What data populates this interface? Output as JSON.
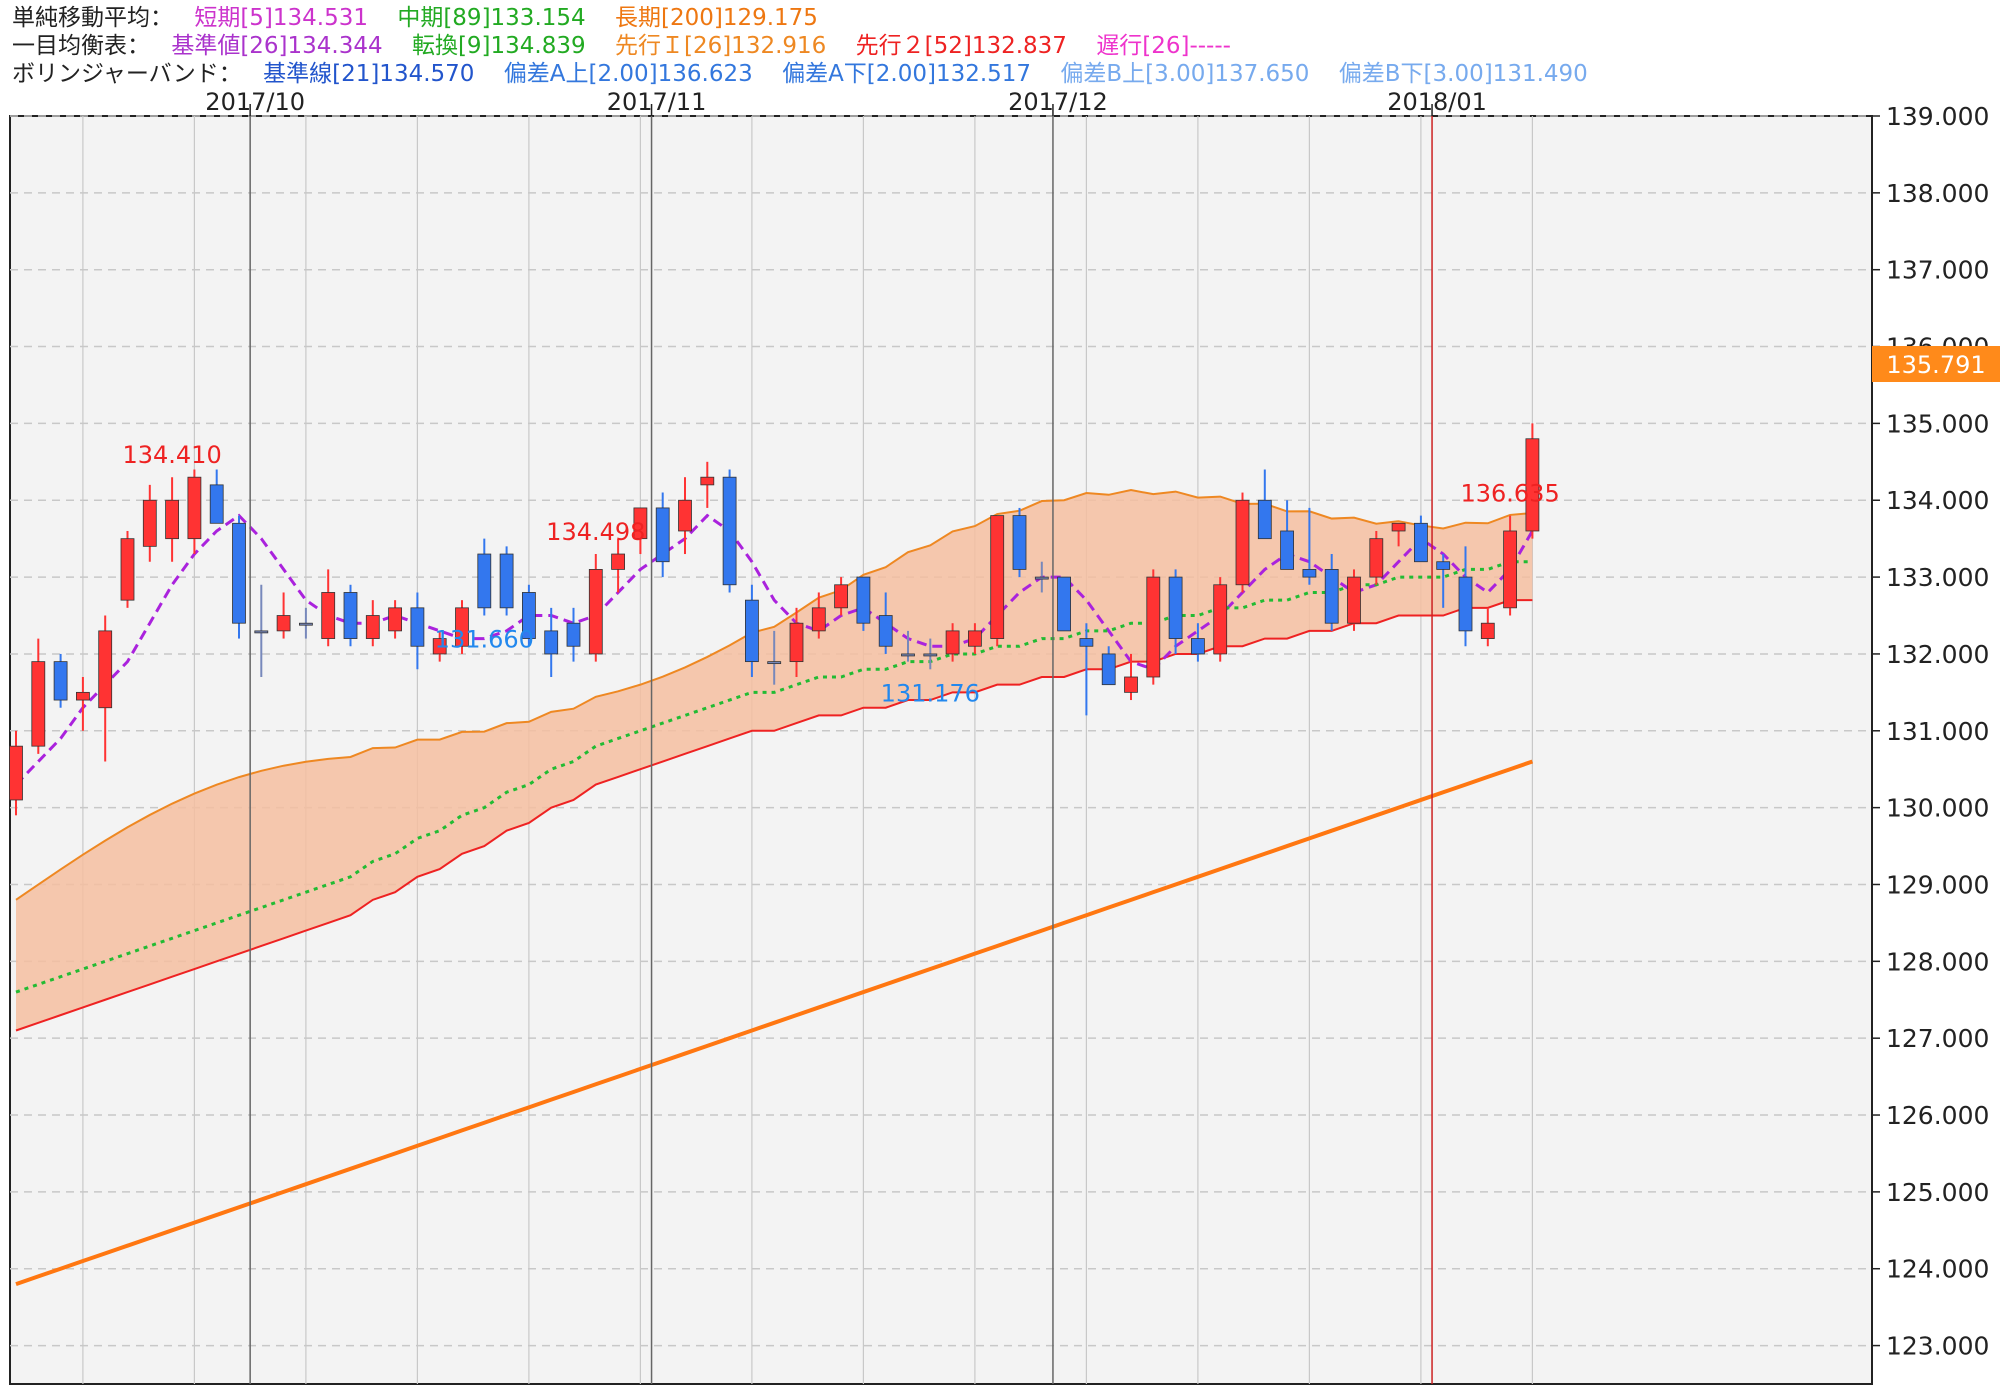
{
  "legend": {
    "sma": {
      "title": "単純移動平均：",
      "items": [
        {
          "text": "短期[5]134.531",
          "color": "#cc33cc"
        },
        {
          "text": "中期[89]133.154",
          "color": "#22aa22"
        },
        {
          "text": "長期[200]129.175",
          "color": "#ee7711"
        }
      ]
    },
    "ichimoku": {
      "title": "一目均衡表：",
      "items": [
        {
          "text": "基準値[26]134.344",
          "color": "#aa33cc"
        },
        {
          "text": "転換[9]134.839",
          "color": "#22aa22"
        },
        {
          "text": "先行Ｉ[26]132.916",
          "color": "#ee8822"
        },
        {
          "text": "先行２[52]132.837",
          "color": "#ee2222"
        },
        {
          "text": "遅行[26]-----",
          "color": "#ee33cc"
        }
      ]
    },
    "bollinger": {
      "title": "ボリンジャーバンド：",
      "items": [
        {
          "text": "基準線[21]134.570",
          "color": "#2255cc"
        },
        {
          "text": "偏差A上[2.00]136.623",
          "color": "#3377dd"
        },
        {
          "text": "偏差A下[2.00]132.517",
          "color": "#3377dd"
        },
        {
          "text": "偏差B上[3.00]137.650",
          "color": "#77aaee"
        },
        {
          "text": "偏差B下[3.00]131.490",
          "color": "#77aaee"
        }
      ]
    }
  },
  "current_price": "135.791",
  "colors": {
    "up": "#ff3333",
    "down": "#3377ee",
    "flat": "#7788bb",
    "cloud": "#f5bea0",
    "background": "#f3f3f3"
  },
  "chart_data": {
    "type": "candlestick",
    "ylim": [
      122.5,
      139.0
    ],
    "yticks": [
      "123.000",
      "124.000",
      "125.000",
      "126.000",
      "127.000",
      "128.000",
      "129.000",
      "130.000",
      "131.000",
      "132.000",
      "133.000",
      "134.000",
      "135.000",
      "136.000",
      "137.000",
      "138.000",
      "139.000"
    ],
    "month_labels": [
      {
        "label": "2017/10",
        "index": 11
      },
      {
        "label": "2017/11",
        "index": 29
      },
      {
        "label": "2017/12",
        "index": 47
      },
      {
        "label": "2018/01",
        "index": 64
      }
    ],
    "annotations": [
      {
        "text": "134.410",
        "type": "high",
        "index": 7
      },
      {
        "text": "134.498",
        "type": "high",
        "index": 26
      },
      {
        "text": "131.660",
        "type": "low",
        "index": 21
      },
      {
        "text": "131.176",
        "type": "low",
        "index": 41
      },
      {
        "text": "136.635",
        "type": "high",
        "index": 67
      }
    ],
    "candles": [
      {
        "o": 130.1,
        "h": 131.0,
        "l": 129.9,
        "c": 130.8
      },
      {
        "o": 130.8,
        "h": 132.2,
        "l": 130.7,
        "c": 131.9
      },
      {
        "o": 131.9,
        "h": 132.0,
        "l": 131.3,
        "c": 131.4
      },
      {
        "o": 131.4,
        "h": 131.7,
        "l": 131.0,
        "c": 131.5
      },
      {
        "o": 131.3,
        "h": 132.5,
        "l": 130.6,
        "c": 132.3
      },
      {
        "o": 132.7,
        "h": 133.6,
        "l": 132.6,
        "c": 133.5
      },
      {
        "o": 133.4,
        "h": 134.2,
        "l": 133.2,
        "c": 134.0
      },
      {
        "o": 133.5,
        "h": 134.3,
        "l": 133.2,
        "c": 134.0
      },
      {
        "o": 133.5,
        "h": 134.4,
        "l": 133.3,
        "c": 134.3
      },
      {
        "o": 134.2,
        "h": 134.4,
        "l": 133.7,
        "c": 133.7
      },
      {
        "o": 133.7,
        "h": 133.8,
        "l": 132.2,
        "c": 132.4
      },
      {
        "o": 132.3,
        "h": 132.9,
        "l": 131.7,
        "c": 132.3
      },
      {
        "o": 132.3,
        "h": 132.8,
        "l": 132.2,
        "c": 132.5
      },
      {
        "o": 132.4,
        "h": 132.6,
        "l": 132.2,
        "c": 132.4
      },
      {
        "o": 132.2,
        "h": 133.1,
        "l": 132.1,
        "c": 132.8
      },
      {
        "o": 132.8,
        "h": 132.9,
        "l": 132.1,
        "c": 132.2
      },
      {
        "o": 132.2,
        "h": 132.7,
        "l": 132.1,
        "c": 132.5
      },
      {
        "o": 132.3,
        "h": 132.7,
        "l": 132.2,
        "c": 132.6
      },
      {
        "o": 132.6,
        "h": 132.8,
        "l": 131.8,
        "c": 132.1
      },
      {
        "o": 132.0,
        "h": 132.3,
        "l": 131.9,
        "c": 132.2
      },
      {
        "o": 132.1,
        "h": 132.7,
        "l": 132.0,
        "c": 132.6
      },
      {
        "o": 133.3,
        "h": 133.5,
        "l": 132.5,
        "c": 132.6
      },
      {
        "o": 133.3,
        "h": 133.4,
        "l": 132.5,
        "c": 132.6
      },
      {
        "o": 132.8,
        "h": 132.9,
        "l": 132.1,
        "c": 132.2
      },
      {
        "o": 132.3,
        "h": 132.6,
        "l": 131.7,
        "c": 132.0
      },
      {
        "o": 132.4,
        "h": 132.6,
        "l": 131.9,
        "c": 132.1
      },
      {
        "o": 132.0,
        "h": 133.3,
        "l": 131.9,
        "c": 133.1
      },
      {
        "o": 133.1,
        "h": 133.5,
        "l": 132.8,
        "c": 133.3
      },
      {
        "o": 133.5,
        "h": 133.9,
        "l": 133.3,
        "c": 133.9
      },
      {
        "o": 133.9,
        "h": 134.1,
        "l": 133.0,
        "c": 133.2
      },
      {
        "o": 133.6,
        "h": 134.3,
        "l": 133.3,
        "c": 134.0
      },
      {
        "o": 134.2,
        "h": 134.5,
        "l": 133.9,
        "c": 134.3
      },
      {
        "o": 134.3,
        "h": 134.4,
        "l": 132.8,
        "c": 132.9
      },
      {
        "o": 132.7,
        "h": 132.9,
        "l": 131.7,
        "c": 131.9
      },
      {
        "o": 131.9,
        "h": 132.3,
        "l": 131.6,
        "c": 131.9
      },
      {
        "o": 131.9,
        "h": 132.6,
        "l": 131.7,
        "c": 132.4
      },
      {
        "o": 132.3,
        "h": 132.8,
        "l": 132.2,
        "c": 132.6
      },
      {
        "o": 132.6,
        "h": 133.0,
        "l": 132.5,
        "c": 132.9
      },
      {
        "o": 133.0,
        "h": 133.0,
        "l": 132.3,
        "c": 132.4
      },
      {
        "o": 132.5,
        "h": 132.8,
        "l": 132.0,
        "c": 132.1
      },
      {
        "o": 132.0,
        "h": 132.3,
        "l": 131.9,
        "c": 132.0
      },
      {
        "o": 132.0,
        "h": 132.2,
        "l": 131.8,
        "c": 132.0
      },
      {
        "o": 132.0,
        "h": 132.4,
        "l": 131.9,
        "c": 132.3
      },
      {
        "o": 132.1,
        "h": 132.4,
        "l": 132.0,
        "c": 132.3
      },
      {
        "o": 132.2,
        "h": 133.8,
        "l": 132.1,
        "c": 133.8
      },
      {
        "o": 133.8,
        "h": 133.9,
        "l": 133.0,
        "c": 133.1
      },
      {
        "o": 133.0,
        "h": 133.2,
        "l": 132.8,
        "c": 133.0
      },
      {
        "o": 133.0,
        "h": 133.0,
        "l": 132.3,
        "c": 132.3
      },
      {
        "o": 132.2,
        "h": 132.4,
        "l": 131.2,
        "c": 132.1
      },
      {
        "o": 132.0,
        "h": 132.1,
        "l": 131.6,
        "c": 131.6
      },
      {
        "o": 131.5,
        "h": 132.0,
        "l": 131.4,
        "c": 131.7
      },
      {
        "o": 131.7,
        "h": 133.1,
        "l": 131.6,
        "c": 133.0
      },
      {
        "o": 133.0,
        "h": 133.1,
        "l": 132.0,
        "c": 132.2
      },
      {
        "o": 132.2,
        "h": 132.4,
        "l": 131.9,
        "c": 132.0
      },
      {
        "o": 132.0,
        "h": 133.0,
        "l": 131.9,
        "c": 132.9
      },
      {
        "o": 132.9,
        "h": 134.1,
        "l": 132.8,
        "c": 134.0
      },
      {
        "o": 134.0,
        "h": 134.4,
        "l": 133.5,
        "c": 133.5
      },
      {
        "o": 133.6,
        "h": 134.0,
        "l": 133.1,
        "c": 133.1
      },
      {
        "o": 133.1,
        "h": 133.9,
        "l": 132.9,
        "c": 133.0
      },
      {
        "o": 133.1,
        "h": 133.3,
        "l": 132.3,
        "c": 132.4
      },
      {
        "o": 132.4,
        "h": 133.1,
        "l": 132.3,
        "c": 133.0
      },
      {
        "o": 133.0,
        "h": 133.6,
        "l": 132.9,
        "c": 133.5
      },
      {
        "o": 133.6,
        "h": 133.7,
        "l": 133.4,
        "c": 133.7
      },
      {
        "o": 133.7,
        "h": 133.8,
        "l": 133.2,
        "c": 133.2
      },
      {
        "o": 133.2,
        "h": 133.3,
        "l": 132.6,
        "c": 133.1
      },
      {
        "o": 133.0,
        "h": 133.4,
        "l": 132.1,
        "c": 132.3
      },
      {
        "o": 132.2,
        "h": 132.6,
        "l": 132.1,
        "c": 132.4
      },
      {
        "o": 132.6,
        "h": 133.8,
        "l": 132.5,
        "c": 133.6
      },
      {
        "o": 133.6,
        "h": 135.0,
        "l": 133.5,
        "c": 134.8
      }
    ],
    "series": [
      {
        "name": "短期[5]",
        "color": "#aa22dd",
        "style": "dashed",
        "values": [
          130.3,
          130.6,
          130.9,
          131.3,
          131.6,
          131.9,
          132.4,
          132.9,
          133.3,
          133.6,
          133.8,
          133.5,
          133.1,
          132.7,
          132.5,
          132.4,
          132.4,
          132.5,
          132.4,
          132.3,
          132.2,
          132.2,
          132.3,
          132.5,
          132.5,
          132.4,
          132.5,
          132.8,
          133.1,
          133.3,
          133.5,
          133.8,
          133.6,
          133.2,
          132.7,
          132.4,
          132.3,
          132.5,
          132.6,
          132.4,
          132.2,
          132.1,
          132.1,
          132.2,
          132.5,
          132.8,
          133.0,
          133.0,
          132.7,
          132.3,
          131.9,
          131.8,
          132.1,
          132.3,
          132.5,
          132.8,
          133.1,
          133.3,
          133.2,
          133.0,
          132.8,
          132.9,
          133.2,
          133.5,
          133.3,
          133.0,
          132.8,
          133.1,
          133.6
        ]
      },
      {
        "name": "中期[89]",
        "color": "#22bb33",
        "style": "dotted",
        "values": [
          127.6,
          127.7,
          127.8,
          127.9,
          128.0,
          128.1,
          128.2,
          128.3,
          128.4,
          128.5,
          128.6,
          128.7,
          128.8,
          128.9,
          129.0,
          129.1,
          129.3,
          129.4,
          129.6,
          129.7,
          129.9,
          130.0,
          130.2,
          130.3,
          130.5,
          130.6,
          130.8,
          130.9,
          131.0,
          131.1,
          131.2,
          131.3,
          131.4,
          131.5,
          131.5,
          131.6,
          131.7,
          131.7,
          131.8,
          131.8,
          131.9,
          131.9,
          132.0,
          132.0,
          132.1,
          132.1,
          132.2,
          132.2,
          132.3,
          132.3,
          132.4,
          132.4,
          132.5,
          132.5,
          132.6,
          132.6,
          132.7,
          132.7,
          132.8,
          132.8,
          132.9,
          132.9,
          133.0,
          133.0,
          133.0,
          133.1,
          133.1,
          133.2,
          133.2
        ]
      },
      {
        "name": "長期[200]",
        "color": "#ff7711",
        "style": "solid",
        "values": [
          123.8,
          123.9,
          124.0,
          124.1,
          124.2,
          124.3,
          124.4,
          124.5,
          124.6,
          124.7,
          124.8,
          124.9,
          125.0,
          125.1,
          125.2,
          125.3,
          125.4,
          125.5,
          125.6,
          125.7,
          125.8,
          125.9,
          126.0,
          126.1,
          126.2,
          126.3,
          126.4,
          126.5,
          126.6,
          126.7,
          126.8,
          126.9,
          127.0,
          127.1,
          127.2,
          127.3,
          127.4,
          127.5,
          127.6,
          127.7,
          127.8,
          127.9,
          128.0,
          128.1,
          128.2,
          128.3,
          128.4,
          128.5,
          128.6,
          128.7,
          128.8,
          128.9,
          129.0,
          129.1,
          129.2,
          129.3,
          129.4,
          129.5,
          129.6,
          129.7,
          129.8,
          129.9,
          130.0,
          130.1,
          130.2,
          130.3,
          130.4,
          130.5,
          130.6
        ]
      }
    ]
  }
}
